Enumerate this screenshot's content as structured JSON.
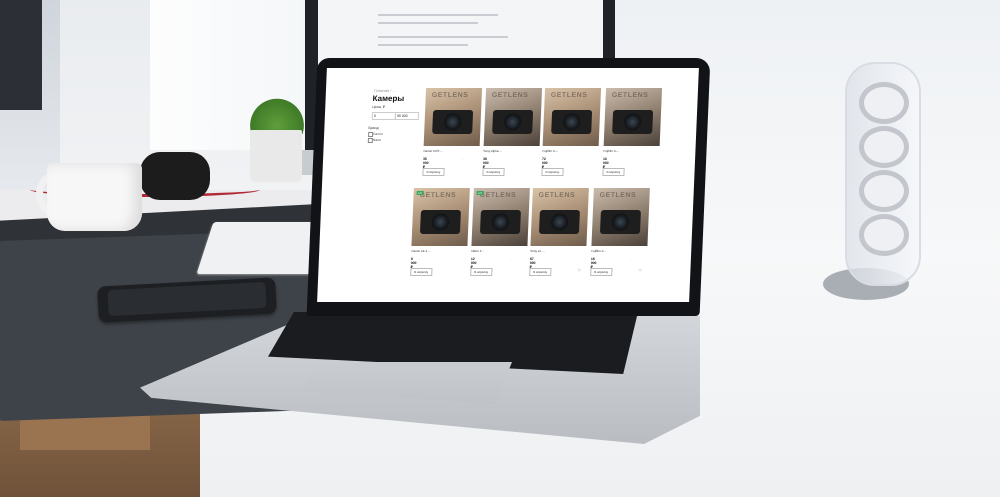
{
  "scene": {
    "description_tag": "laptop-on-desk"
  },
  "shop": {
    "breadcrumb": "Главная / ...",
    "title": "Камеры",
    "price_label": "Цена, ₽",
    "price_from": "0",
    "price_to": "99 000",
    "brand_label": "Бренд",
    "brands": [
      "Canon",
      "Nikon"
    ],
    "logo_text": "GETLENS",
    "used_badge": "Б/У",
    "cart_label": "В корзину",
    "products": [
      {
        "name": "Canon EOS ...",
        "price": "35 000 ₽",
        "note": "..."
      },
      {
        "name": "Sony Alpha ...",
        "price": "38 000 ₽",
        "note": ""
      },
      {
        "name": "Fujifilm X-...",
        "price": "72 000 ₽",
        "note": ""
      },
      {
        "name": "Fujifilm X-...",
        "price": "16 000 ₽",
        "note": ""
      },
      {
        "name": "Canon AE-1 ...",
        "price": "8 000 ₽",
        "note": ""
      },
      {
        "name": "Nikon F...",
        "price": "12 000 ₽",
        "note": "..."
      },
      {
        "name": "Sony a7 ...",
        "price": "87 000 ₽",
        "note": ""
      },
      {
        "name": "Fujifilm X...",
        "price": "18 000 ₽",
        "note": "..."
      }
    ]
  }
}
